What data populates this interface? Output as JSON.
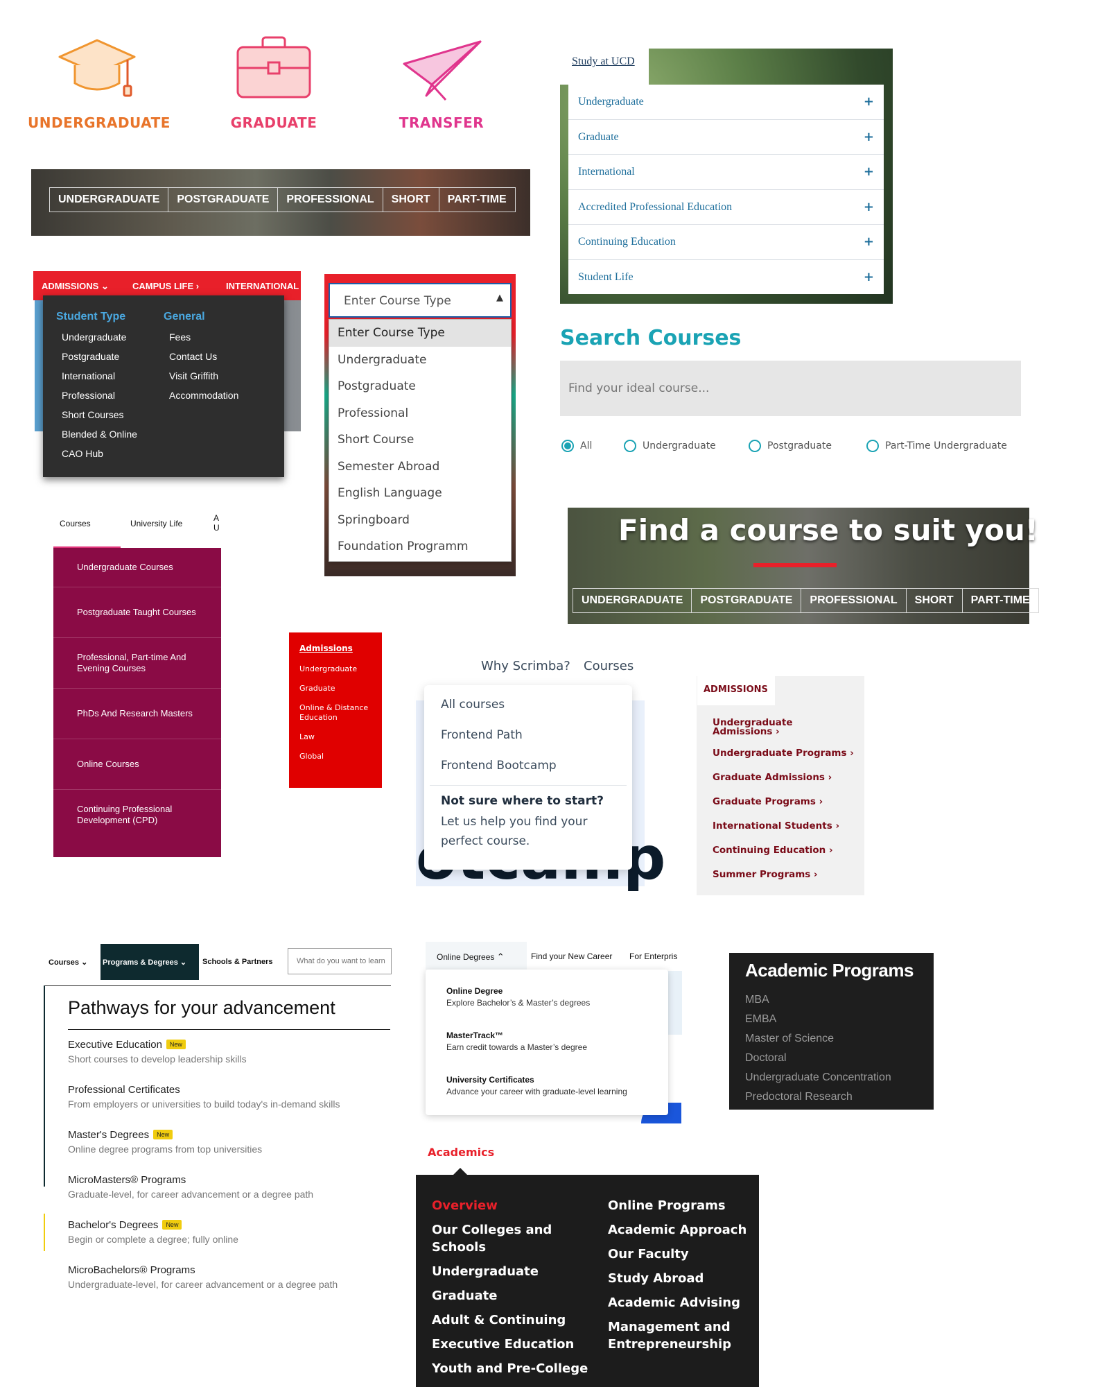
{
  "icons": {
    "undergraduate": {
      "label": "UNDERGRADUATE",
      "color": "#e8742a"
    },
    "graduate": {
      "label": "GRADUATE",
      "color": "#e8406b"
    },
    "transfer": {
      "label": "TRANSFER",
      "color": "#e0358d"
    }
  },
  "photo_tabs": [
    "UNDERGRADUATE",
    "POSTGRADUATE",
    "PROFESSIONAL",
    "SHORT",
    "PART-TIME"
  ],
  "ucd": {
    "tab": "Study at UCD",
    "items": [
      "Undergraduate",
      "Graduate",
      "International",
      "Accredited Professional Education",
      "Continuing Education",
      "Student Life"
    ]
  },
  "griffith": {
    "nav": [
      "ADMISSIONS",
      "CAMPUS LIFE",
      "INTERNATIONAL"
    ],
    "col1": {
      "heading": "Student Type",
      "items": [
        "Undergraduate",
        "Postgraduate",
        "International",
        "Professional",
        "Short Courses",
        "Blended & Online",
        "CAO Hub"
      ]
    },
    "col2": {
      "heading": "General",
      "items": [
        "Fees",
        "Contact Us",
        "Visit Griffith",
        "Accommodation"
      ]
    }
  },
  "course_select": {
    "value": "Enter Course Type",
    "options": [
      "Enter Course Type",
      "Undergraduate",
      "Postgraduate",
      "Professional",
      "Short Course",
      "Semester Abroad",
      "English Language",
      "Springboard",
      "Foundation Programm"
    ]
  },
  "search_courses": {
    "title": "Search Courses",
    "placeholder": "Find your ideal course...",
    "options": [
      "All",
      "Undergraduate",
      "Postgraduate",
      "Part-Time Undergraduate"
    ],
    "selected": "All"
  },
  "find_course": {
    "title": "Find a course to suit you!",
    "tabs": [
      "UNDERGRADUATE",
      "POSTGRADUATE",
      "PROFESSIONAL",
      "SHORT",
      "PART-TIME"
    ]
  },
  "maroon": {
    "nav": [
      "Courses",
      "University Life",
      "A\nU"
    ],
    "items": [
      "Undergraduate Courses",
      "Postgraduate Taught Courses",
      "Professional, Part-time And Evening Courses",
      "PhDs And Research Masters",
      "Online Courses",
      "Continuing Professional Development (CPD)"
    ]
  },
  "red_admissions": {
    "heading": "Admissions",
    "items": [
      "Undergraduate",
      "Graduate",
      "Online & Distance Education",
      "Law",
      "Global"
    ]
  },
  "scrimba": {
    "nav": [
      "Why Scrimba?",
      "Courses"
    ],
    "items": [
      "All courses",
      "Frontend Path",
      "Frontend Bootcamp"
    ],
    "cta_title": "Not sure where to start?",
    "cta_text": "Let us help you find your perfect course."
  },
  "admissions2": {
    "tab": "ADMISSIONS",
    "items": [
      "Undergraduate Admissions",
      "Undergraduate Programs",
      "Graduate Admissions",
      "Graduate Programs",
      "International Students",
      "Continuing Education",
      "Summer Programs"
    ]
  },
  "edx": {
    "nav": [
      "Courses",
      "Programs & Degrees",
      "Schools & Partners"
    ],
    "search_placeholder": "What do you want to learn",
    "title": "Pathways for your advancement",
    "new_label": "New",
    "items": [
      {
        "title": "Executive Education",
        "desc": "Short courses to develop leadership skills",
        "new": true
      },
      {
        "title": "Professional Certificates",
        "desc": "From employers or universities to build today's in-demand skills",
        "new": false
      },
      {
        "title": "Master's Degrees",
        "desc": "Online degree programs from top universities",
        "new": true
      },
      {
        "title": "MicroMasters® Programs",
        "desc": "Graduate-level, for career advancement or a degree path",
        "new": false
      },
      {
        "title": "Bachelor's Degrees",
        "desc": "Begin or complete a degree; fully online",
        "new": true
      },
      {
        "title": "MicroBachelors® Programs",
        "desc": "Undergraduate-level, for career advancement or a degree path",
        "new": false
      }
    ]
  },
  "coursera": {
    "nav": [
      "Online Degrees",
      "Find your New Career",
      "For Enterpris"
    ],
    "items": [
      {
        "title": "Online Degree",
        "desc": "Explore Bachelor’s & Master’s degrees"
      },
      {
        "title": "MasterTrack™",
        "desc": "Earn credit towards a Master’s degree"
      },
      {
        "title": "University Certificates",
        "desc": "Advance your career with graduate-level learning"
      }
    ]
  },
  "academic_programs": {
    "title": "Academic Programs",
    "items": [
      "MBA",
      "EMBA",
      "Master of Science",
      "Doctoral",
      "Undergraduate Concentration",
      "Predoctoral Research"
    ]
  },
  "academics": {
    "label": "Academics",
    "col1": [
      "Overview",
      "Our Colleges and Schools",
      "Undergraduate",
      "Graduate",
      "Adult & Continuing",
      "Executive Education",
      "Youth and Pre-College"
    ],
    "col2": [
      "Online Programs",
      "Academic Approach",
      "Our Faculty",
      "Study Abroad",
      "Academic Advising",
      "Management and Entrepreneurship"
    ]
  }
}
